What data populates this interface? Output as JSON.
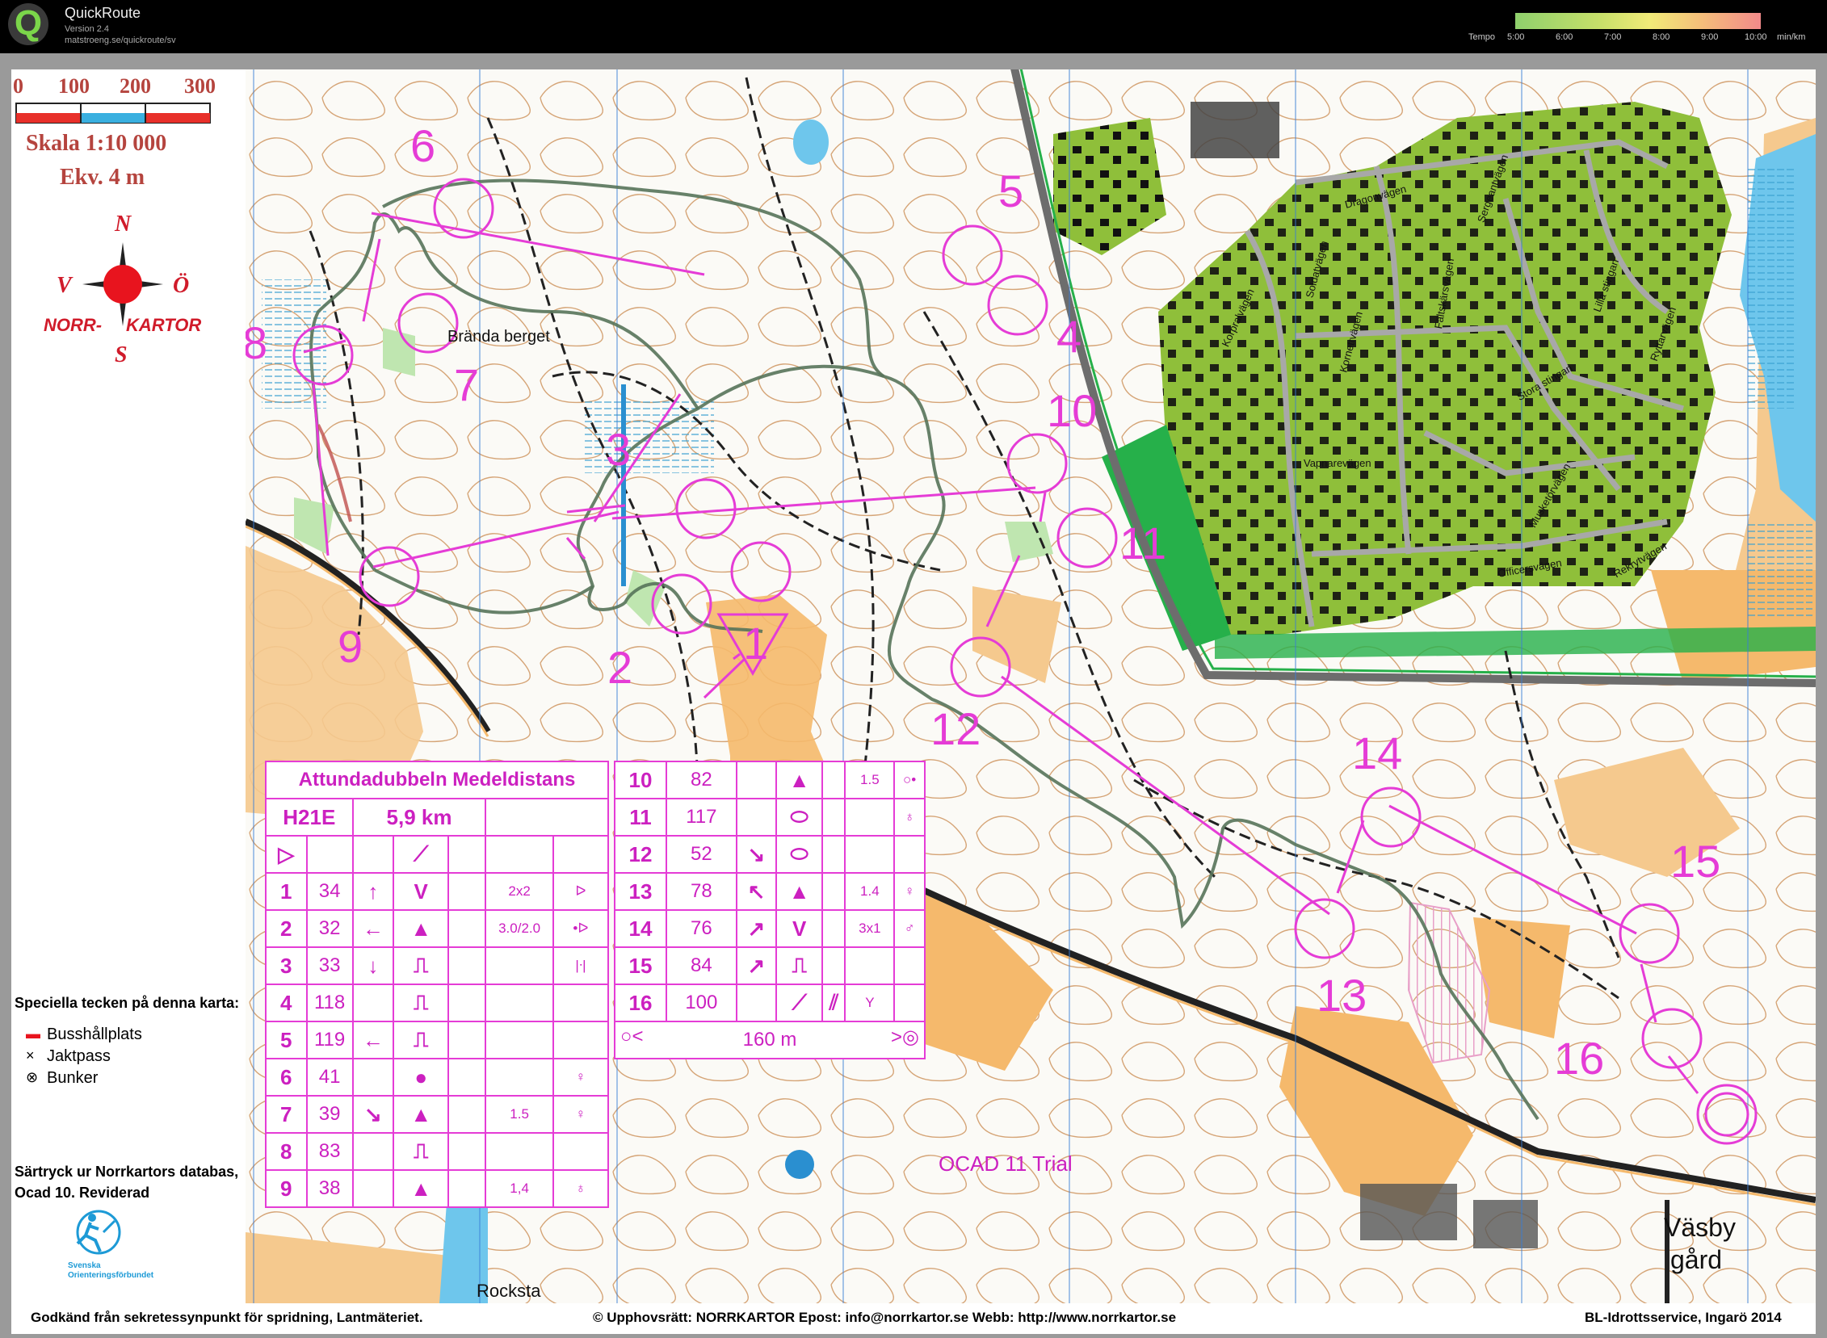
{
  "app": {
    "name": "QuickRoute",
    "version": "Version 2.4",
    "url": "matstroeng.se/quickroute/sv",
    "tempo_label": "Tempo",
    "tempo_ticks": [
      "5:00",
      "6:00",
      "7:00",
      "8:00",
      "9:00",
      "10:00"
    ],
    "tempo_unit": "min/km"
  },
  "legend": {
    "scale_numbers": [
      "0",
      "100",
      "200",
      "300"
    ],
    "scale_text": "Skala 1:10 000",
    "ekv_text": "Ekv. 4 m",
    "compass": {
      "n": "N",
      "s": "S",
      "w": "V",
      "e": "Ö"
    },
    "brand_left": "NORR-",
    "brand_right": "KARTOR",
    "special_title": "Speciella tecken på denna karta:",
    "special_items": [
      {
        "symbol": "▬",
        "label": "Busshållplats"
      },
      {
        "symbol": "×",
        "label": "Jaktpass"
      },
      {
        "symbol": "⊗",
        "label": "Bunker"
      }
    ],
    "reprint_line1": "Särtryck ur Norrkartors databas,",
    "reprint_line2": "Ocad 10. Reviderad",
    "federation": "Svenska Orienteringsförbundet"
  },
  "map": {
    "place_names": [
      "Brända berget",
      "Väsby",
      "gård",
      "Rocksta",
      "Kornettvägen",
      "Soldatvägen",
      "Vapnarevägen",
      "Officersvägen",
      "Rekrytvägen",
      "Stora stingan",
      "Lilla stingan",
      "Ryttarvägen",
      "Korpralvägen",
      "Fältskärsvägen",
      "Musketörvägen",
      "Dragonvägen",
      "Sergeantvägen"
    ],
    "controls": [
      "1",
      "2",
      "3",
      "4",
      "5",
      "6",
      "7",
      "8",
      "9",
      "10",
      "11",
      "12",
      "13",
      "14",
      "15",
      "16"
    ]
  },
  "description_sheet": {
    "title": "Attundadubbeln Medeldistans",
    "class": "H21E",
    "length": "5,9 km",
    "start_row": [
      "▷",
      "",
      "",
      "⟋",
      "",
      "",
      ""
    ],
    "left_rows": [
      [
        "1",
        "34",
        "↑",
        "V",
        "",
        "2x2",
        "ᐅ"
      ],
      [
        "2",
        "32",
        "←",
        "▲",
        "",
        "3.0/2.0",
        "•ᐅ"
      ],
      [
        "3",
        "33",
        "↓",
        "⎍",
        "",
        "",
        "|ᐧ|"
      ],
      [
        "4",
        "118",
        "",
        "⎍",
        "",
        "",
        ""
      ],
      [
        "5",
        "119",
        "←",
        "⎍",
        "",
        "",
        ""
      ],
      [
        "6",
        "41",
        "",
        "●",
        "",
        "",
        "♀"
      ],
      [
        "7",
        "39",
        "↘",
        "▲",
        "",
        "1.5",
        "♀"
      ],
      [
        "8",
        "83",
        "",
        "⎍",
        "",
        "",
        ""
      ],
      [
        "9",
        "38",
        "",
        "▲",
        "",
        "1,4",
        "♁"
      ]
    ],
    "right_rows": [
      [
        "10",
        "82",
        "",
        "▲",
        "",
        "1.5",
        "○•"
      ],
      [
        "11",
        "117",
        "",
        "⬭",
        "",
        "",
        "♁"
      ],
      [
        "12",
        "52",
        "↘",
        "⬭",
        "",
        "",
        ""
      ],
      [
        "13",
        "78",
        "↖",
        "▲",
        "",
        "1.4",
        "♀"
      ],
      [
        "14",
        "76",
        "↗",
        "V",
        "",
        "3x1",
        "♂"
      ],
      [
        "15",
        "84",
        "↗",
        "⎍",
        "",
        "",
        ""
      ],
      [
        "16",
        "100",
        "",
        "⟋",
        "⫽",
        "Y",
        ""
      ]
    ],
    "finish_text": "160 m",
    "trial_text": "OCAD 11 Trial"
  },
  "footer": {
    "left": "Godkänd från sekretessynpunkt  för spridning, Lantmäteriet.",
    "middle": "©  Upphovsrätt: NORRKARTOR  Epost: info@norrkartor.se      Webb: http://www.norrkartor.se",
    "right": "BL-Idrottsservice, Ingarö 2014"
  },
  "colors": {
    "overprint": "#e53cd6",
    "route": "#56735a",
    "forest_green": "#8fbf3a",
    "open_yellow": "#f5b96c"
  }
}
